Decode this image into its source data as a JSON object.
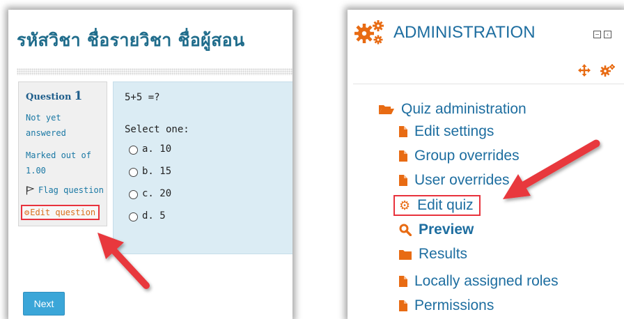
{
  "left": {
    "course_title": "รหัสวิชา ชื่อรายวิชา ชื่อผู้สอน",
    "question": {
      "label": "Question",
      "number": "1",
      "status": "Not yet answered",
      "marked": "Marked out of 1.00",
      "flag_label": "Flag question",
      "edit_label": "Edit question"
    },
    "content": {
      "text": "5+5 =?",
      "prompt": "Select one:",
      "options": [
        "a. 10",
        "b. 15",
        "c. 20",
        "d. 5"
      ]
    },
    "next_label": "Next"
  },
  "right": {
    "title": "ADMINISTRATION",
    "section_label": "Quiz administration",
    "items": [
      {
        "label": "Edit settings",
        "icon": "file-icon"
      },
      {
        "label": "Group overrides",
        "icon": "file-icon"
      },
      {
        "label": "User overrides",
        "icon": "file-icon"
      },
      {
        "label": "Edit quiz",
        "icon": "gear-icon"
      },
      {
        "label": "Preview",
        "icon": "search-icon"
      },
      {
        "label": "Results",
        "icon": "folder-icon"
      },
      {
        "label": "Locally assigned roles",
        "icon": "file-icon"
      },
      {
        "label": "Permissions",
        "icon": "file-icon"
      }
    ]
  },
  "colors": {
    "accent": "#1e6ea0",
    "icon_orange": "#e86b13",
    "highlight_red": "#e8323c",
    "button_blue": "#3ba6d8",
    "content_bg": "#dbecf4"
  }
}
